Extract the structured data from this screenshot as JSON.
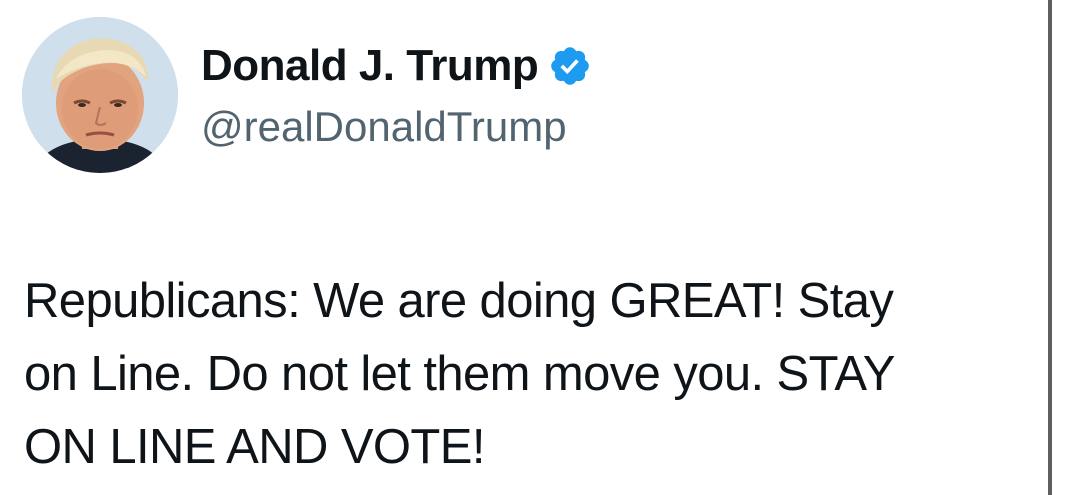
{
  "tweet": {
    "author": {
      "display_name": "Donald J. Trump",
      "handle": "@realDonaldTrump",
      "verified": true,
      "verified_icon": "verified-badge-icon",
      "verified_color": "#1d9bf0"
    },
    "text": "Republicans: We are doing GREAT! Stay\non Line. Do not let them move you. STAY\nON LINE AND VOTE!"
  },
  "colors": {
    "text_primary": "#0f1419",
    "text_secondary": "#536471",
    "accent": "#1d9bf0"
  }
}
